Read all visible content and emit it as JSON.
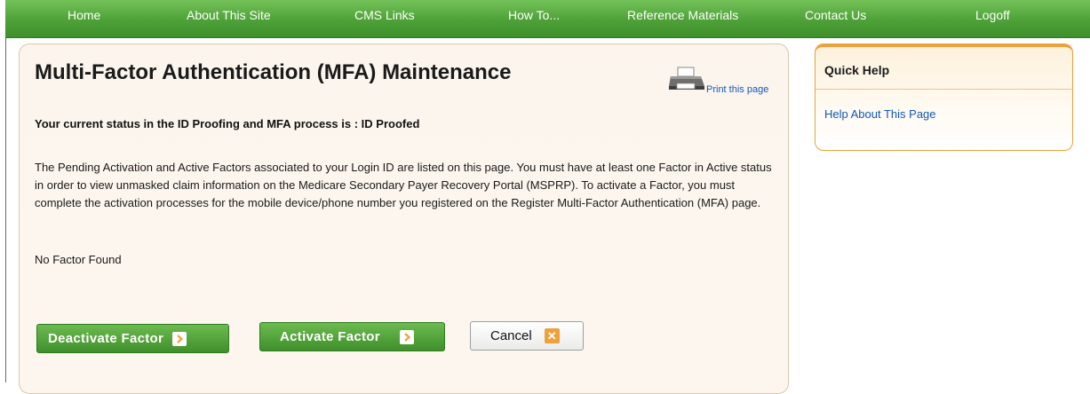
{
  "nav": {
    "items": [
      {
        "label": "Home"
      },
      {
        "label": "About This Site"
      },
      {
        "label": "CMS Links"
      },
      {
        "label": "How To..."
      },
      {
        "label": "Reference Materials"
      },
      {
        "label": "Contact Us"
      },
      {
        "label": "Logoff"
      }
    ]
  },
  "main": {
    "title": "Multi-Factor Authentication (MFA) Maintenance",
    "print_link": "Print this page",
    "status_text": "Your current status in the ID Proofing and MFA process is :  ID Proofed",
    "description": "The Pending Activation and Active Factors associated to your Login ID are listed on this page. You must have at least one Factor in Active status in order to view unmasked claim information on the Medicare Secondary Payer Recovery Portal (MSPRP). To activate a Factor, you must complete the activation processes for the mobile device/phone number you registered on the Register Multi-Factor Authentication (MFA) page.",
    "no_factor": "No Factor Found",
    "buttons": {
      "deactivate": "Deactivate Factor",
      "activate": "Activate Factor",
      "cancel": "Cancel"
    }
  },
  "quick_help": {
    "title": "Quick Help",
    "link": "Help About This Page"
  },
  "colors": {
    "nav_green": "#4da137",
    "button_green": "#3f8f2c",
    "link_blue": "#1257b8",
    "quick_help_orange": "#f0a03a"
  }
}
